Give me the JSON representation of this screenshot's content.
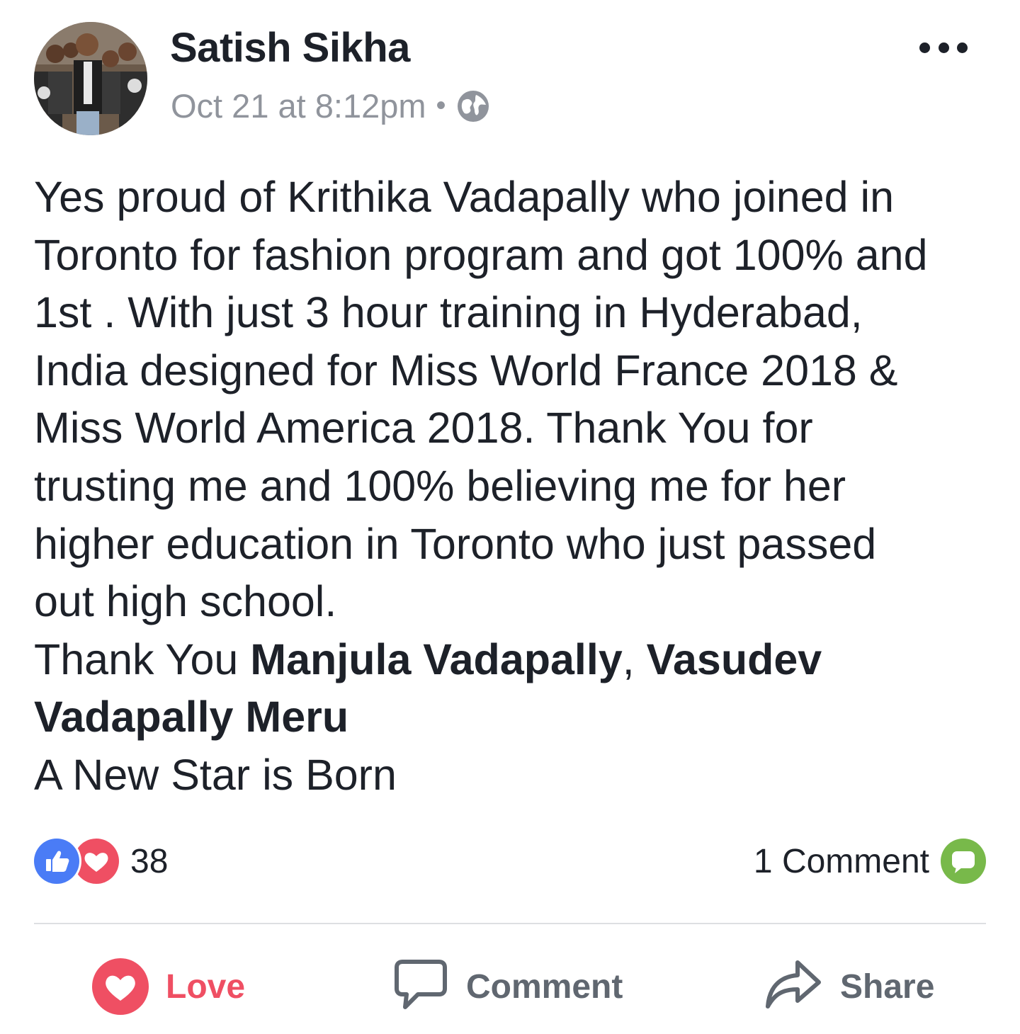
{
  "post": {
    "author": "Satish Sikha",
    "timestamp": "Oct 21 at 8:12pm",
    "separator": "•",
    "privacy_icon": "globe-icon",
    "more_icon": "more-options-icon",
    "body": {
      "line1": "Yes proud of Krithika Vadapally  who joined in",
      "line2": "Toronto for fashion program and got 100% and",
      "line3": "1st . With just 3 hour training in Hyderabad,",
      "line4": "India designed for Miss World France 2018 &",
      "line5": "Miss World America 2018. Thank You for",
      "line6": "trusting me and 100% believing me for her",
      "line7": "higher education in Toronto who just passed",
      "line8": "out high school.",
      "thanks_prefix": "Thank You ",
      "tag1": "Manjula Vadapally",
      "tag_sep": ", ",
      "tag2_part1": "Vasudev",
      "tag2_part2": "Vadapally Meru",
      "closing": "A New Star is Born"
    }
  },
  "engagement": {
    "reaction_icons": [
      "like-icon",
      "love-icon"
    ],
    "reaction_count": "38",
    "comments_label": "1 Comment",
    "comment_icon": "comment-bubble-icon"
  },
  "actions": {
    "love_label": "Love",
    "comment_label": "Comment",
    "share_label": "Share"
  },
  "colors": {
    "love": "#ef4f63",
    "like": "#4a7cf6",
    "comment": "#78b94a",
    "muted": "#90949c",
    "text": "#1d2129"
  }
}
